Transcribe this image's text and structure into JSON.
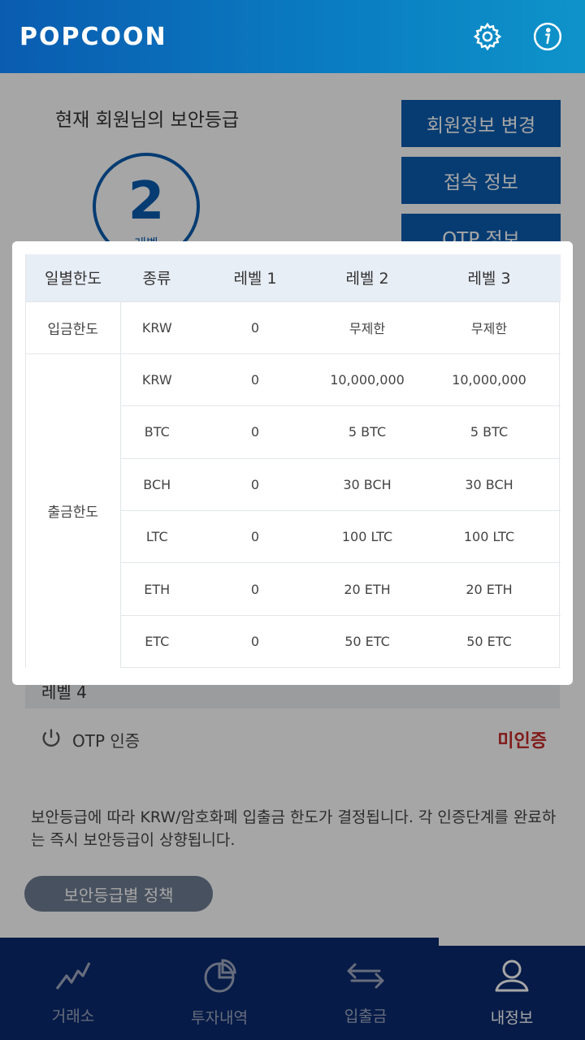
{
  "header": {
    "logo_text": "POPCOON",
    "icons": [
      "gear-icon",
      "info-icon"
    ]
  },
  "security": {
    "title": "현재 회원님의 보안등급",
    "level_number": "2",
    "level_unit": "레벨",
    "buttons": [
      "회원정보 변경",
      "접속 정보",
      "OTP 정보"
    ]
  },
  "verification": {
    "level4_label": "레벨 4",
    "otp_label": "OTP 인증",
    "otp_status": "미인증"
  },
  "notice": "보안등급에 따라 KRW/암호화폐 입출금 한도가 결정됩니다. 각 인증단계를 완료하는 즉시 보안등급이 상향됩니다.",
  "policy_button": "보안등급별 정책",
  "modal": {
    "headers": [
      "일별한도",
      "종류",
      "레벨 1",
      "레벨 2",
      "레벨 3"
    ],
    "deposit": {
      "group": "입금한도",
      "rows": [
        [
          "KRW",
          "0",
          "무제한",
          "무제한"
        ]
      ]
    },
    "withdraw": {
      "group": "출금한도",
      "rows": [
        [
          "KRW",
          "0",
          "10,000,000",
          "10,000,000"
        ],
        [
          "BTC",
          "0",
          "5 BTC",
          "5 BTC"
        ],
        [
          "BCH",
          "0",
          "30 BCH",
          "30 BCH"
        ],
        [
          "LTC",
          "0",
          "100 LTC",
          "100 LTC"
        ],
        [
          "ETH",
          "0",
          "20 ETH",
          "20 ETH"
        ],
        [
          "ETC",
          "0",
          "50 ETC",
          "50 ETC"
        ]
      ]
    }
  },
  "bottom_nav": [
    {
      "label": "거래소",
      "icon": "chart-line-icon",
      "active": false
    },
    {
      "label": "투자내역",
      "icon": "pie-chart-icon",
      "active": false
    },
    {
      "label": "입출금",
      "icon": "transfer-arrows-icon",
      "active": false
    },
    {
      "label": "내정보",
      "icon": "user-icon",
      "active": true
    }
  ],
  "colors": {
    "primary": "#0a5cb0",
    "nav_bg": "#0a2a6e",
    "alert": "#c62828"
  }
}
